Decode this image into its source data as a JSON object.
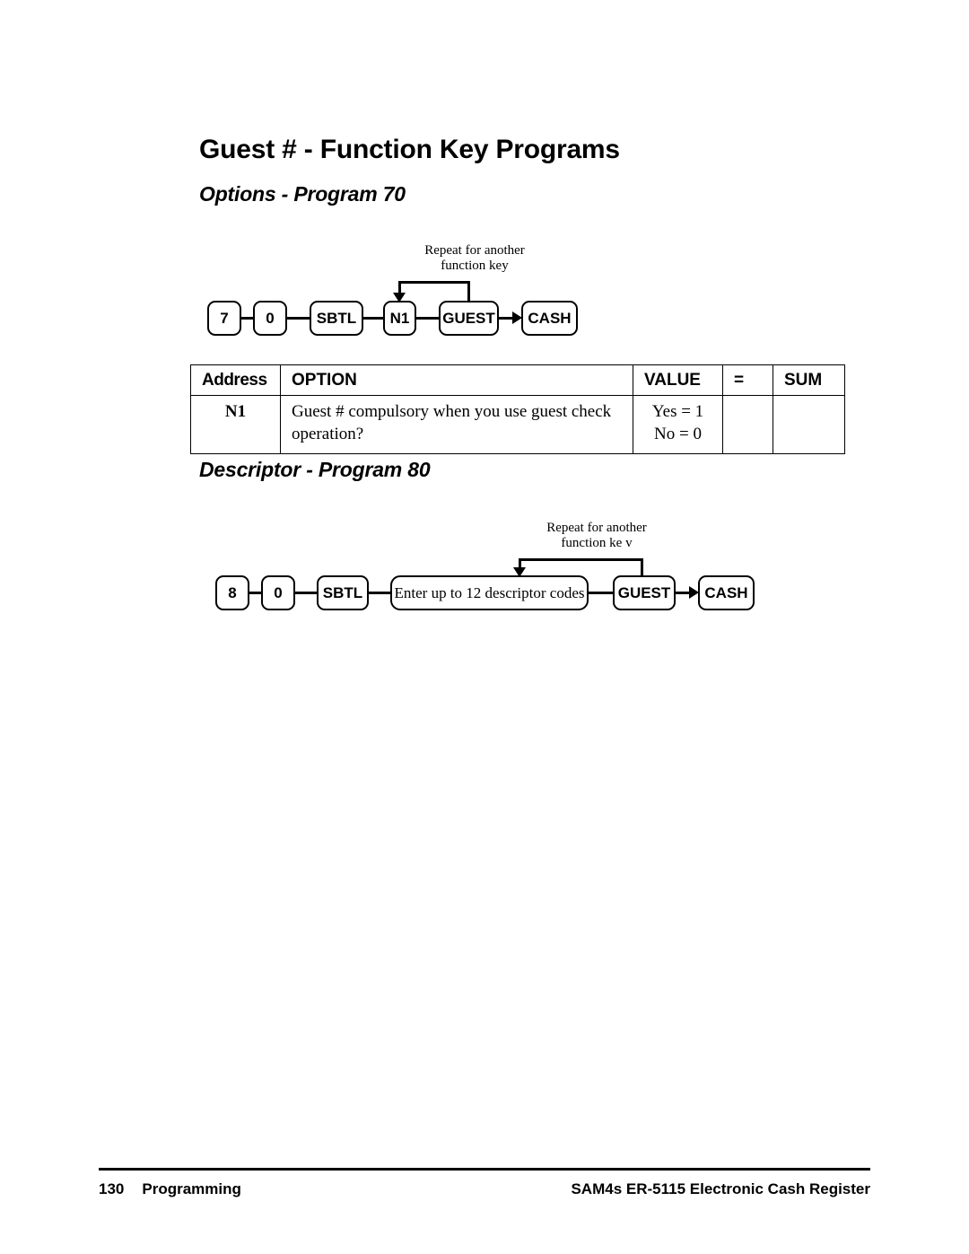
{
  "page": {
    "title": "Guest # - Function Key Programs"
  },
  "sections": [
    {
      "heading": "Options - Program 70",
      "flow": {
        "loop_label_line1": "Repeat for another",
        "loop_label_line2": "function key",
        "keys": [
          {
            "label": "7",
            "type": "digit"
          },
          {
            "label": "0",
            "type": "digit"
          },
          {
            "label": "SBTL",
            "type": "key"
          },
          {
            "label": "N1",
            "type": "key"
          },
          {
            "label": "GUEST",
            "type": "key"
          },
          {
            "label": "CASH",
            "type": "key"
          }
        ]
      },
      "table": {
        "headers": [
          "Address",
          "OPTION",
          "VALUE",
          "=",
          "SUM"
        ],
        "rows": [
          {
            "address": "N1",
            "option": "Guest # compulsory when you use guest check operation?",
            "value_line1": "Yes = 1",
            "value_line2": "No = 0",
            "equals": "",
            "sum": ""
          }
        ]
      }
    },
    {
      "heading": "Descriptor - Program 80",
      "flow": {
        "loop_label_line1": "Repeat for another",
        "loop_label_line2": "function ke v",
        "keys": [
          {
            "label": "8",
            "type": "digit"
          },
          {
            "label": "0",
            "type": "digit"
          },
          {
            "label": "SBTL",
            "type": "key"
          },
          {
            "label": "Enter up to 12 descriptor codes",
            "type": "note"
          },
          {
            "label": "GUEST",
            "type": "key"
          },
          {
            "label": "CASH",
            "type": "key"
          }
        ]
      }
    }
  ],
  "footer": {
    "page_number": "130",
    "section_name": "Programming",
    "product": "SAM4s ER-5115 Electronic Cash Register"
  },
  "colors": {
    "ink": "#000000",
    "paper": "#ffffff"
  }
}
